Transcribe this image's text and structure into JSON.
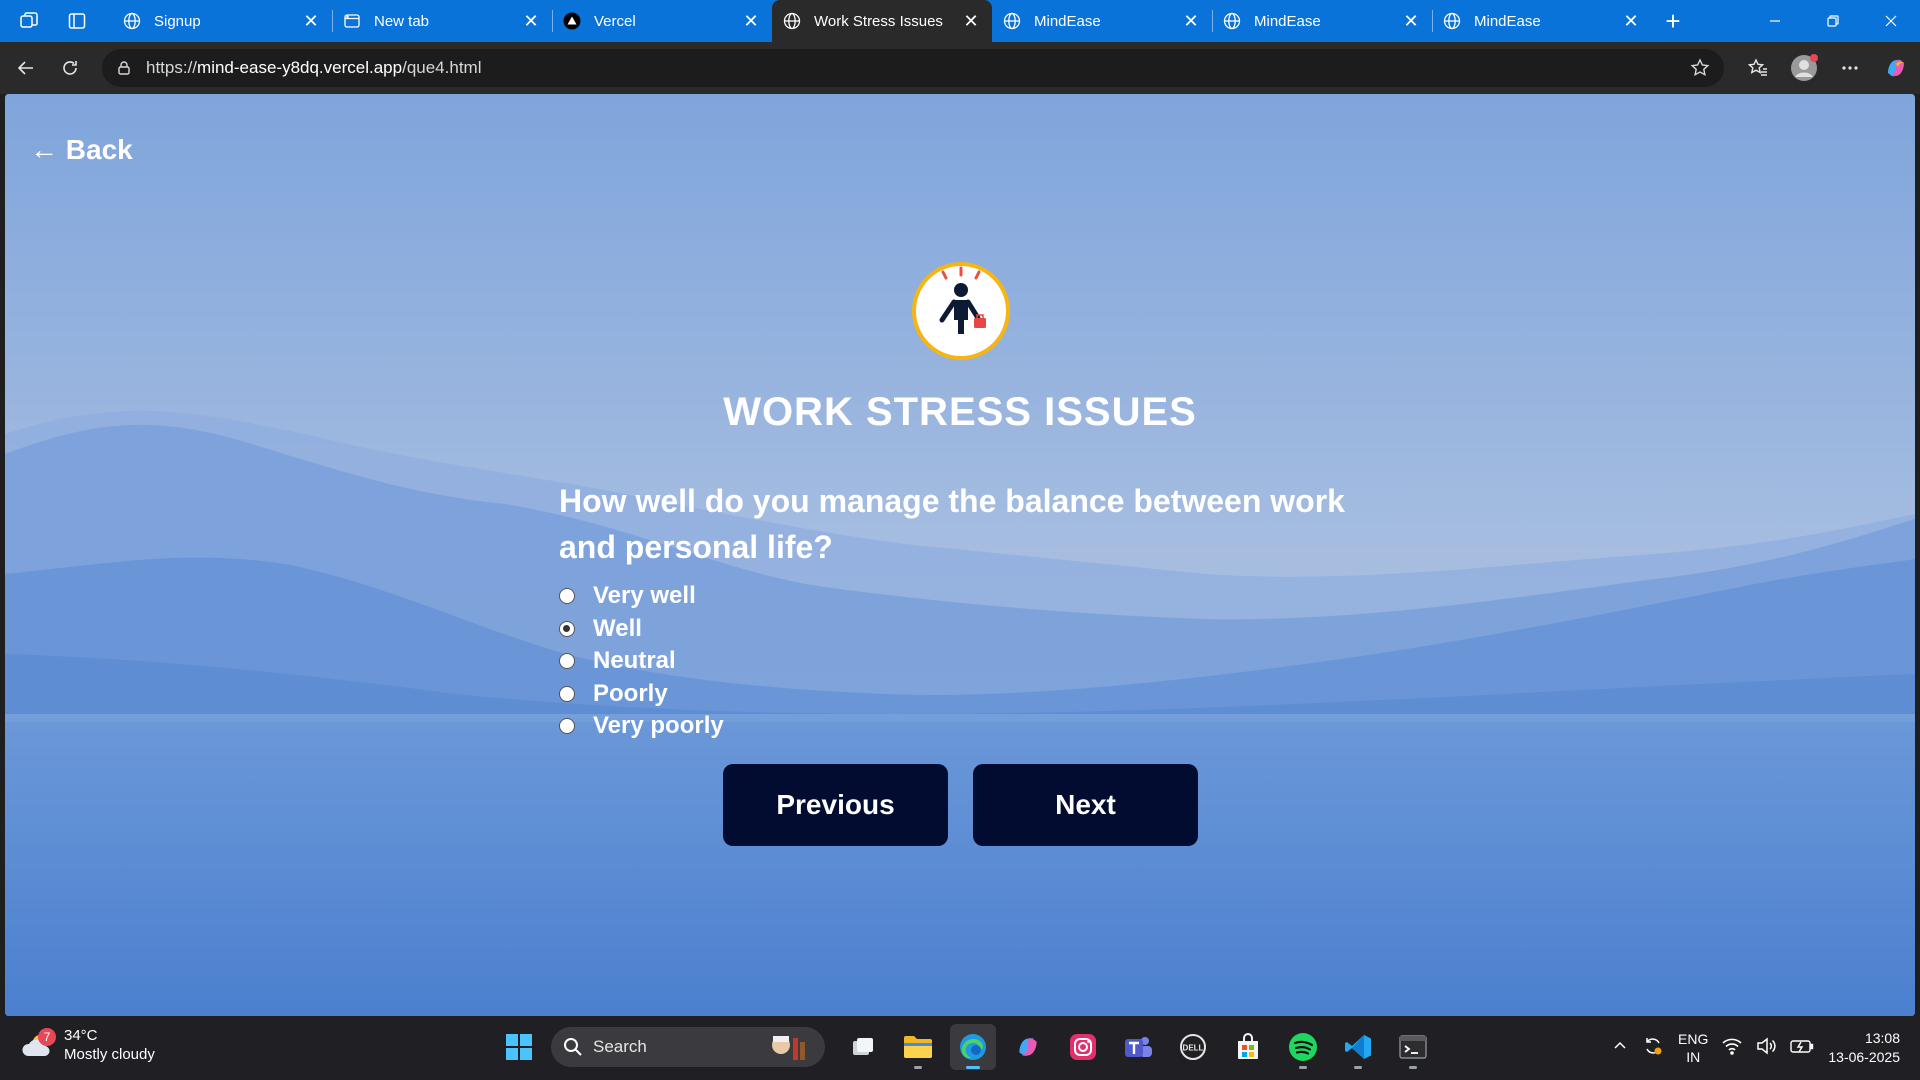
{
  "browser": {
    "tabs": [
      {
        "title": "Signup",
        "favicon": "globe-icon",
        "active": false
      },
      {
        "title": "New tab",
        "favicon": "newtab-icon",
        "active": false
      },
      {
        "title": "Vercel",
        "favicon": "vercel-icon",
        "active": false
      },
      {
        "title": "Work Stress Issues",
        "favicon": "globe-icon",
        "active": true
      },
      {
        "title": "MindEase",
        "favicon": "globe-icon",
        "active": false
      },
      {
        "title": "MindEase",
        "favicon": "globe-icon",
        "active": false
      },
      {
        "title": "MindEase",
        "favicon": "globe-icon",
        "active": false
      }
    ],
    "close_glyph": "✕",
    "new_tab_glyph": "+",
    "address": {
      "prefix": "https://",
      "host": "mind-ease-y8dq.vercel.app",
      "path": "/que4.html"
    }
  },
  "page": {
    "back_label": "← Back",
    "title": "WORK STRESS ISSUES",
    "question": "How well do you manage the balance between work and personal life?",
    "options": [
      {
        "label": "Very well",
        "checked": false
      },
      {
        "label": "Well",
        "checked": true
      },
      {
        "label": "Neutral",
        "checked": false
      },
      {
        "label": "Poorly",
        "checked": false
      },
      {
        "label": "Very poorly",
        "checked": false
      }
    ],
    "previous_label": "Previous",
    "next_label": "Next"
  },
  "taskbar": {
    "weather": {
      "badge": "7",
      "temp": "34°C",
      "condition": "Mostly cloudy"
    },
    "search_label": "Search",
    "tray": {
      "lang_top": "ENG",
      "lang_bottom": "IN",
      "time": "13:08",
      "date": "13-06-2025"
    }
  },
  "colors": {
    "tabbar": "#0a73d9",
    "button_bg": "#020c30",
    "logo_ring": "#f7b514",
    "active_indicator": "#4cc2ff"
  }
}
